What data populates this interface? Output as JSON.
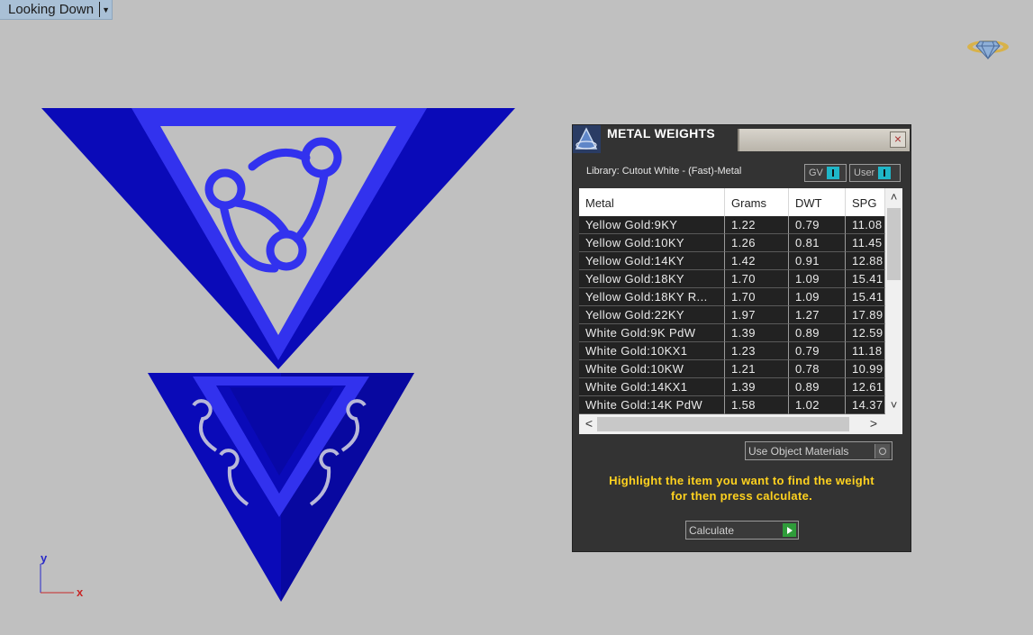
{
  "viewport": {
    "label": "Looking Down",
    "axis_y": "y",
    "axis_x": "x"
  },
  "panel": {
    "title": "METAL WEIGHTS",
    "library": "Library: Cutout White - (Fast)-Metal",
    "toggle_gv": "GV",
    "toggle_user": "User",
    "columns": [
      "Metal",
      "Grams",
      "DWT",
      "SPG"
    ],
    "rows": [
      [
        "Yellow Gold:9KY",
        "1.22",
        "0.79",
        "11.08"
      ],
      [
        "Yellow Gold:10KY",
        "1.26",
        "0.81",
        "11.45"
      ],
      [
        "Yellow Gold:14KY",
        "1.42",
        "0.91",
        "12.88"
      ],
      [
        "Yellow Gold:18KY",
        "1.70",
        "1.09",
        "15.41"
      ],
      [
        "Yellow Gold:18KY R...",
        "1.70",
        "1.09",
        "15.41"
      ],
      [
        "Yellow Gold:22KY",
        "1.97",
        "1.27",
        "17.89"
      ],
      [
        "White Gold:9K PdW",
        "1.39",
        "0.89",
        "12.59"
      ],
      [
        "White Gold:10KX1",
        "1.23",
        "0.79",
        "11.18"
      ],
      [
        "White Gold:10KW",
        "1.21",
        "0.78",
        "10.99"
      ],
      [
        "White Gold:14KX1",
        "1.39",
        "0.89",
        "12.61"
      ],
      [
        "White Gold:14K PdW",
        "1.58",
        "1.02",
        "14.37"
      ]
    ],
    "use_materials_label": "Use Object Materials",
    "instruction_line1": "Highlight the item you want to find the weight",
    "instruction_line2": "for then press calculate.",
    "calculate_label": "Calculate"
  },
  "colors": {
    "viewport_bg": "#c0c0c0",
    "model_dark": "#0a0ab8",
    "model_light": "#3535f0",
    "instruction_text": "#ffd21f",
    "toggle_accent": "#1fb6c8",
    "calculate_play": "#2f9c3a"
  }
}
